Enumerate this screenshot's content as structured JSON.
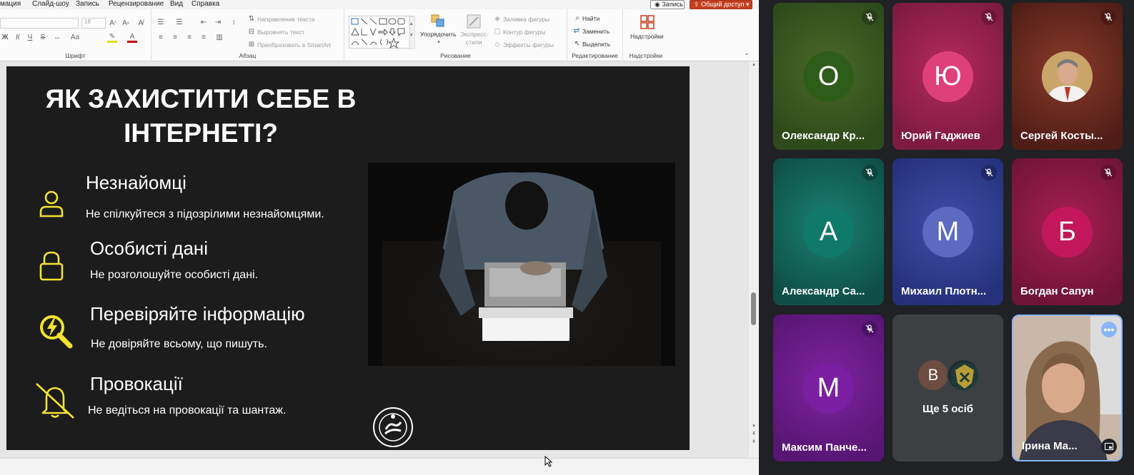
{
  "menu": {
    "items": [
      "мация",
      "Слайд-шоу",
      "Запись",
      "Рецензирование",
      "Вид",
      "Справка"
    ],
    "record_label": "Запись",
    "share_label": "Общий доступ"
  },
  "ribbon": {
    "font_group": {
      "label": "Шрифт",
      "font_size": "18",
      "bold": "Ж",
      "italic": "К",
      "underline": "Ч",
      "strike": "S"
    },
    "paragraph_group": {
      "label": "Абзац",
      "text_direction": "Направление текста",
      "align_text": "Выровнять текст",
      "smartart": "Преобразовать в SmartArt"
    },
    "drawing_group": {
      "label": "Рисование",
      "arrange": "Упорядочить",
      "quick_styles_1": "Экспресс-",
      "quick_styles_2": "стили",
      "shape_fill": "Заливка фигуры",
      "shape_outline": "Контур фигуры",
      "shape_effects": "Эффекты фигуры"
    },
    "editing_group": {
      "label": "Редактирование",
      "find": "Найти",
      "replace": "Заменить",
      "select": "Выделить"
    },
    "addins_group": {
      "label": "Надстройки",
      "addins": "Надстройки"
    }
  },
  "slide": {
    "title_line1": "ЯК ЗАХИСТИТИ СЕБЕ В",
    "title_line2": "ІНТЕРНЕТІ?",
    "items": [
      {
        "heading": "Незнайомці",
        "text": "Не спілкуйтеся з підозрілими незнайомцями.",
        "icon": "person-icon"
      },
      {
        "heading": "Особисті дані",
        "text": "Не розголошуйте особисті дані.",
        "icon": "lock-icon"
      },
      {
        "heading": "Перевіряйте інформацію",
        "text": "Не довіряйте всьому, що пишуть.",
        "icon": "magnifier-bolt-icon"
      },
      {
        "heading": "Провокації",
        "text": "Не ведіться на провокації та шантаж.",
        "icon": "bell-off-icon"
      }
    ],
    "accent_color": "#f2e230",
    "background_color": "#1c1c1c"
  },
  "participants": [
    {
      "initial": "О",
      "name": "Олександр Кр...",
      "avatar_color": "#2e5d1a",
      "bg": "#3b5a22",
      "muted": true
    },
    {
      "initial": "Ю",
      "name": "Юрий Гаджиев",
      "avatar_color": "#e0407a",
      "bg": "#9a1f4c",
      "muted": true
    },
    {
      "initial": "",
      "name": "Сергей Косты...",
      "avatar_color": "#c9c2b8",
      "bg": "#6e2e24",
      "muted": true
    },
    {
      "initial": "А",
      "name": "Александр Са...",
      "avatar_color": "#0f7a6a",
      "bg": "#115c54",
      "muted": true
    },
    {
      "initial": "М",
      "name": "Михаил Плотн...",
      "avatar_color": "#5c6bc0",
      "bg": "#2e3c8c",
      "muted": true
    },
    {
      "initial": "Б",
      "name": "Богдан Сапун",
      "avatar_color": "#c2185b",
      "bg": "#8f1844",
      "muted": true
    },
    {
      "initial": "М",
      "name": "Максим Панче...",
      "avatar_color": "#7b1fa2",
      "bg": "#6a1e8e",
      "muted": true
    },
    {
      "initial": "В",
      "name": "Ще 5 осіб",
      "avatar_color": "#6d4c41",
      "bg": "#3c4043",
      "muted": false
    },
    {
      "initial": "",
      "name": "Ірина Ма...",
      "avatar_color": "#b08a70",
      "bg": "#7a6458",
      "muted": false
    }
  ]
}
